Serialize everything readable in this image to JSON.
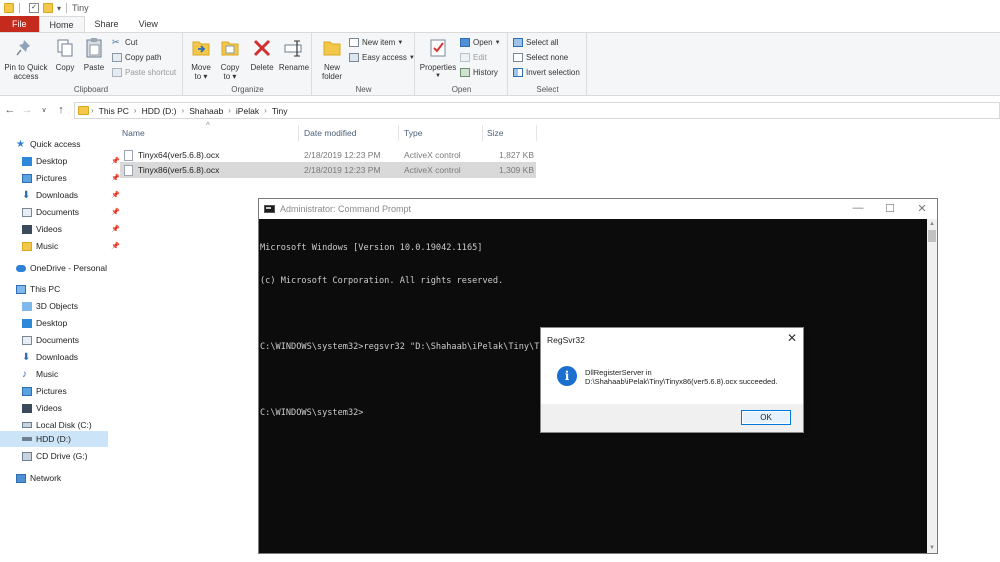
{
  "window": {
    "title": "Tiny"
  },
  "ribbon_tabs": [
    {
      "label": "File"
    },
    {
      "label": "Home"
    },
    {
      "label": "Share"
    },
    {
      "label": "View"
    }
  ],
  "ribbon": {
    "clipboard": {
      "label": "Clipboard",
      "pin_label_1": "Pin to Quick",
      "pin_label_2": "access",
      "copy": "Copy",
      "paste": "Paste",
      "cut": "Cut",
      "copy_path": "Copy path",
      "paste_shortcut": "Paste shortcut"
    },
    "organize": {
      "label": "Organize",
      "move_to_1": "Move",
      "move_to_2": "to",
      "copy_to_1": "Copy",
      "copy_to_2": "to",
      "delete": "Delete",
      "rename": "Rename"
    },
    "new": {
      "label": "New",
      "new_folder_1": "New",
      "new_folder_2": "folder",
      "new_item": "New item",
      "easy_access": "Easy access"
    },
    "open": {
      "label": "Open",
      "properties": "Properties",
      "open": "Open",
      "edit": "Edit",
      "history": "History"
    },
    "select": {
      "label": "Select",
      "select_all": "Select all",
      "select_none": "Select none",
      "invert_selection": "Invert selection"
    }
  },
  "breadcrumb": [
    "This PC",
    "HDD (D:)",
    "Shahaab",
    "iPelak",
    "Tiny"
  ],
  "nav_pane": {
    "quick_access": "Quick access",
    "quick_items": [
      "Desktop",
      "Pictures",
      "Downloads",
      "Documents",
      "Videos",
      "Music"
    ],
    "onedrive": "OneDrive - Personal",
    "this_pc": "This PC",
    "pc_items": [
      "3D Objects",
      "Desktop",
      "Documents",
      "Downloads",
      "Music",
      "Pictures",
      "Videos",
      "Local Disk (C:)",
      "HDD (D:)",
      "CD Drive (G:)"
    ],
    "network": "Network",
    "selected": "HDD (D:)"
  },
  "file_list": {
    "columns": [
      "Name",
      "Date modified",
      "Type",
      "Size"
    ],
    "rows": [
      {
        "name": "Tinyx64(ver5.6.8).ocx",
        "date": "2/18/2019 12:23 PM",
        "type": "ActiveX control",
        "size": "1,827 KB"
      },
      {
        "name": "Tinyx86(ver5.6.8).ocx",
        "date": "2/18/2019 12:23 PM",
        "type": "ActiveX control",
        "size": "1,309 KB"
      }
    ]
  },
  "cmd": {
    "title": "Administrator: Command Prompt",
    "lines": [
      "Microsoft Windows [Version 10.0.19042.1165]",
      "(c) Microsoft Corporation. All rights reserved.",
      "",
      "C:\\WINDOWS\\system32>regsvr32 \"D:\\Shahaab\\iPelak\\Tiny\\Tinyx86(ver5.6.8).ocx\"",
      "",
      "C:\\WINDOWS\\system32>"
    ]
  },
  "dialog": {
    "title": "RegSvr32",
    "message_line1": "DllRegisterServer in",
    "message_line2": "D:\\Shahaab\\iPelak\\Tiny\\Tinyx86(ver5.6.8).ocx succeeded.",
    "ok": "OK"
  },
  "colors": {
    "file_tab": "#c42b1c",
    "selection": "#cce4f7",
    "console_bg": "#0c0c0c",
    "console_text": "#cccccc",
    "info_icon": "#1b6fcf"
  }
}
